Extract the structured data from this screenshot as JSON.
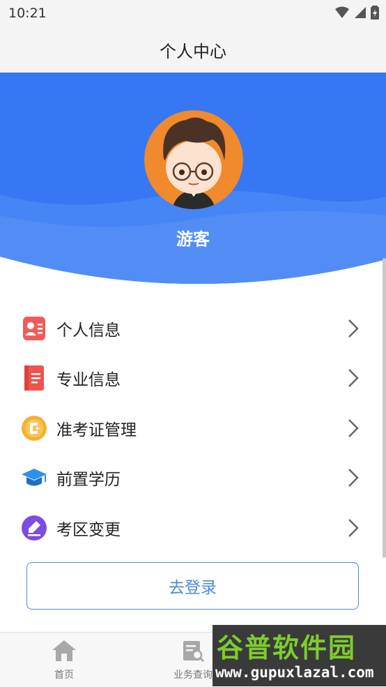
{
  "status_bar": {
    "time": "10:21"
  },
  "header": {
    "title": "个人中心"
  },
  "profile": {
    "name": "游客"
  },
  "menu": [
    {
      "label": "个人信息",
      "icon": "id-card-icon",
      "color": "#f25a5a"
    },
    {
      "label": "专业信息",
      "icon": "book-icon",
      "color": "#f0534b"
    },
    {
      "label": "准考证管理",
      "icon": "admission-ticket-icon",
      "color": "#f5b031"
    },
    {
      "label": "前置学历",
      "icon": "graduation-cap-icon",
      "color": "#2f8fe8"
    },
    {
      "label": "考区变更",
      "icon": "pen-edit-icon",
      "color": "#7b4de0"
    }
  ],
  "login_button": {
    "label": "去登录"
  },
  "tabbar": [
    {
      "label": "首页",
      "icon": "home-icon"
    },
    {
      "label": "业务查询",
      "icon": "search-document-icon"
    }
  ],
  "watermark": {
    "line1": "谷普软件园",
    "line2": "www.gupuxlazal.com"
  },
  "colors": {
    "banner": "#3777f3",
    "accent": "#4a8bd9"
  }
}
